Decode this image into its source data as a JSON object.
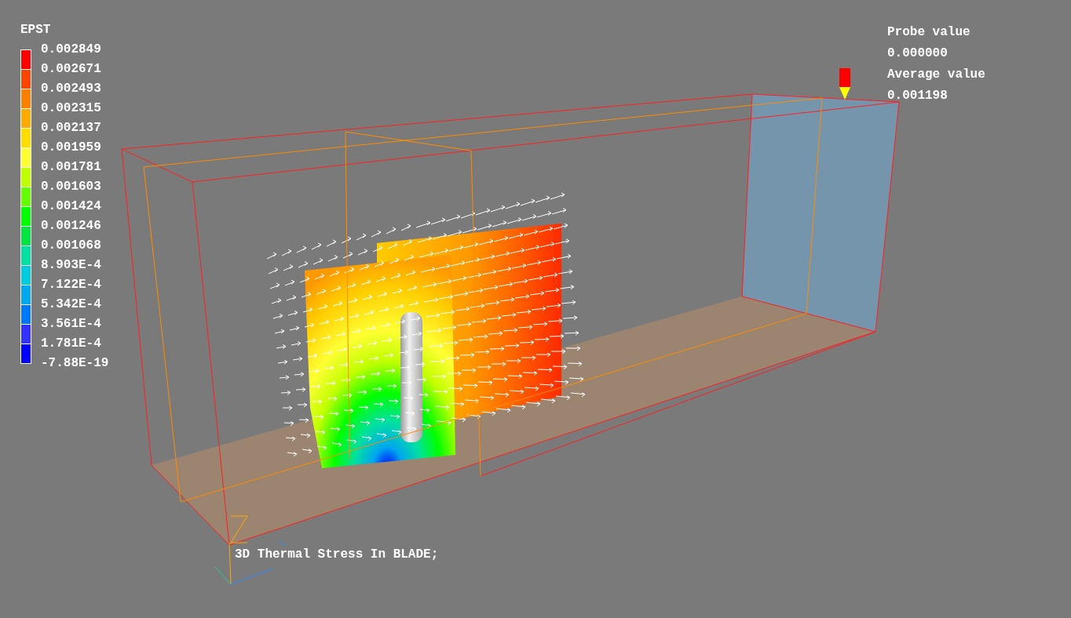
{
  "legend": {
    "title": "EPST",
    "labels": [
      "0.002849",
      "0.002671",
      "0.002493",
      "0.002315",
      "0.002137",
      "0.001959",
      "0.001781",
      "0.001603",
      "0.001424",
      "0.001246",
      "0.001068",
      "8.903E-4",
      "7.122E-4",
      "5.342E-4",
      "3.561E-4",
      "1.781E-4",
      "-7.88E-19"
    ],
    "swatches": [
      {
        "color": "#ff0000"
      },
      {
        "color": "#ff4400"
      },
      {
        "color": "#ff7f00"
      },
      {
        "color": "#ffaa00"
      },
      {
        "color": "#ffdd00"
      },
      {
        "color": "#ffff33"
      },
      {
        "color": "#c0ff00"
      },
      {
        "color": "#66ff00"
      },
      {
        "color": "#00ff00"
      },
      {
        "color": "#00e640"
      },
      {
        "color": "#00e0a0"
      },
      {
        "color": "#00ccdd"
      },
      {
        "color": "#00a8ee"
      },
      {
        "color": "#0077ff"
      },
      {
        "color": "#3333ff"
      },
      {
        "color": "#0000ff"
      }
    ]
  },
  "probe": {
    "label": "Probe value",
    "value": "0.000000"
  },
  "average": {
    "label": "Average value",
    "value": "0.001198"
  },
  "caption": "3D Thermal Stress In BLADE;"
}
